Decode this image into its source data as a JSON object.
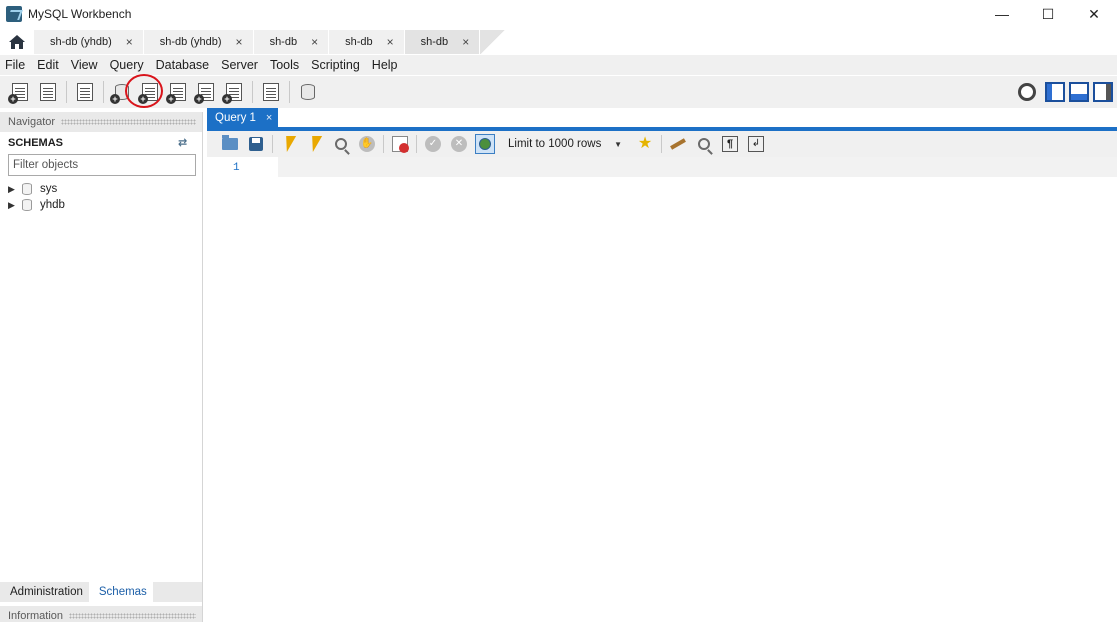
{
  "window": {
    "title": "MySQL Workbench"
  },
  "connection_tabs": [
    {
      "label": "sh-db (yhdb)",
      "active": false
    },
    {
      "label": "sh-db (yhdb)",
      "active": false
    },
    {
      "label": "sh-db",
      "active": false
    },
    {
      "label": "sh-db",
      "active": false
    },
    {
      "label": "sh-db",
      "active": true
    }
  ],
  "tab_close_glyph": "×",
  "menu": [
    "File",
    "Edit",
    "View",
    "Query",
    "Database",
    "Server",
    "Tools",
    "Scripting",
    "Help"
  ],
  "navigator": {
    "header": "Navigator",
    "schemas_title": "SCHEMAS",
    "filter_placeholder": "Filter objects",
    "schemas": [
      "sys",
      "yhdb"
    ],
    "bottom_tabs": [
      "Administration",
      "Schemas"
    ],
    "active_bottom_tab": "Schemas",
    "info_header": "Information"
  },
  "editor": {
    "tab_label": "Query 1",
    "limit_label": "Limit to 1000 rows",
    "line_numbers": [
      "1"
    ]
  },
  "colors": {
    "accent": "#1c70c6",
    "highlight_ring": "#d9141b"
  }
}
